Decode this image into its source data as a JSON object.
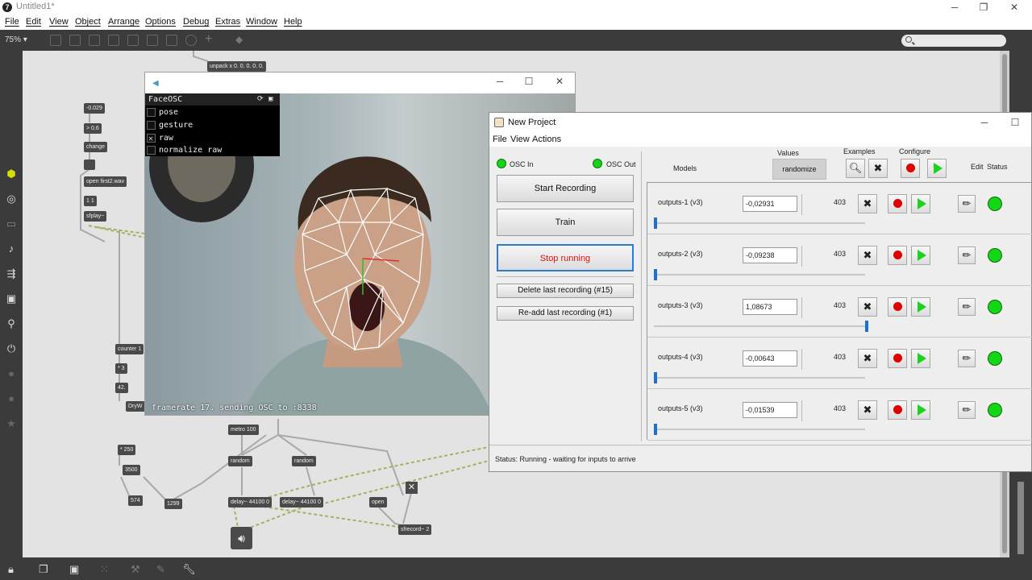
{
  "max": {
    "title": "Untitled1*",
    "menu": [
      "File",
      "Edit",
      "View",
      "Object",
      "Arrange",
      "Options",
      "Debug",
      "Extras",
      "Window",
      "Help"
    ],
    "zoom": "75%"
  },
  "patch": {
    "objects": [
      {
        "text": "unpack x 0. 0. 0. 0. 0."
      },
      {
        "text": "-0.029"
      },
      {
        "text": "> 0.6"
      },
      {
        "text": "change"
      },
      {
        "text": "open first2.wav"
      },
      {
        "text": "1 1"
      },
      {
        "text": "sfplay~"
      },
      {
        "text": "counter 1"
      },
      {
        "text": "* 3"
      },
      {
        "text": "42."
      },
      {
        "text": "DryW"
      },
      {
        "text": "* 250"
      },
      {
        "text": "3500"
      },
      {
        "text": "metro 100"
      },
      {
        "text": "random"
      },
      {
        "text": "random"
      },
      {
        "text": "574"
      },
      {
        "text": "1299"
      },
      {
        "text": "delay~ 44100 0"
      },
      {
        "text": "delay~ 44100 0"
      },
      {
        "text": "open"
      },
      {
        "text": "sfrecord~ 2"
      }
    ]
  },
  "faceosc": {
    "panel_title": "FaceOSC",
    "items": [
      {
        "label": "pose",
        "checked": false
      },
      {
        "label": "gesture",
        "checked": false
      },
      {
        "label": "raw",
        "checked": true
      },
      {
        "label": "normalize raw",
        "checked": false
      }
    ],
    "footer": "framerate 17. sending OSC to :8338"
  },
  "wekinator": {
    "title": "New Project",
    "menu": [
      "File",
      "View",
      "Actions"
    ],
    "osc_in": "OSC In",
    "osc_out": "OSC Out",
    "buttons": {
      "start_recording": "Start Recording",
      "train": "Train",
      "stop_running": "Stop running",
      "delete_last": "Delete last recording (#15)",
      "readd_last": "Re-add last recording (#1)"
    },
    "headers": {
      "models": "Models",
      "values": "Values",
      "randomize": "randomize",
      "examples": "Examples",
      "configure": "Configure",
      "edit": "Edit",
      "status": "Status"
    },
    "rows": [
      {
        "name": "outputs-1 (v3)",
        "value": "-0,02931",
        "count": "403",
        "slider_fraction": 0.0
      },
      {
        "name": "outputs-2 (v3)",
        "value": "-0,09238",
        "count": "403",
        "slider_fraction": 0.0
      },
      {
        "name": "outputs-3 (v3)",
        "value": "1,08673",
        "count": "403",
        "slider_fraction": 1.0
      },
      {
        "name": "outputs-4 (v3)",
        "value": "-0,00643",
        "count": "403",
        "slider_fraction": 0.0
      },
      {
        "name": "outputs-5 (v3)",
        "value": "-0,01539",
        "count": "403",
        "slider_fraction": 0.0
      }
    ],
    "status": "Status:  Running - waiting for inputs to arrive",
    "colors": {
      "led_green": "#16d416",
      "record_red": "#e00000",
      "play_green": "#1fd11f",
      "focus_blue": "#2f7ad9"
    }
  }
}
